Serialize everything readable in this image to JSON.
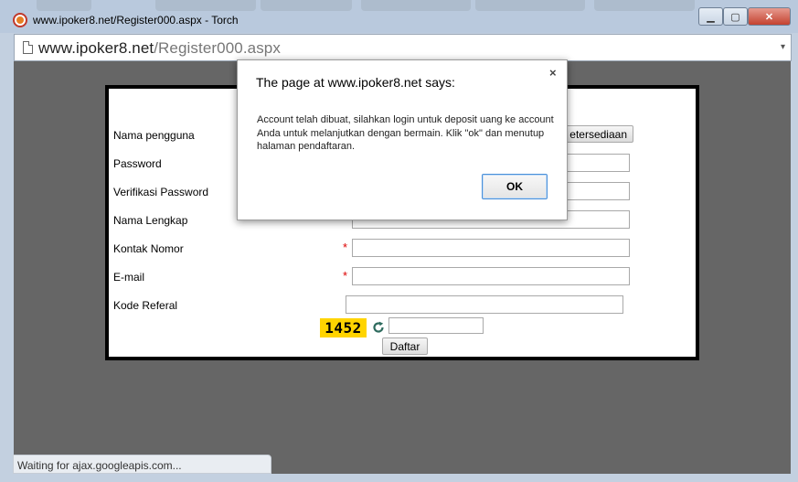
{
  "window": {
    "title": "www.ipoker8.net/Register000.aspx - Torch",
    "controls": {
      "minimize": "▁",
      "maximize": "▢",
      "close": "✕"
    }
  },
  "address_bar": {
    "host": "www.ipoker8.net",
    "path": "/Register000.aspx",
    "dropdown_icon": "▾"
  },
  "form": {
    "fields": [
      {
        "label": "Nama pengguna",
        "required": false,
        "value": ""
      },
      {
        "label": "Password",
        "required": false,
        "value": ""
      },
      {
        "label": "Verifikasi Password",
        "required": false,
        "value": ""
      },
      {
        "label": "Nama Lengkap",
        "required": false,
        "value": ""
      },
      {
        "label": "Kontak Nomor",
        "required": true,
        "value": ""
      },
      {
        "label": "E-mail",
        "required": true,
        "value": ""
      },
      {
        "label": "Kode Referal",
        "required": false,
        "value": ""
      }
    ],
    "required_marker": "*",
    "availability_button": "etersediaan",
    "captcha_code": "1452",
    "captcha_input": "",
    "submit_button": "Daftar"
  },
  "dialog": {
    "title": "The page at www.ipoker8.net says:",
    "message": "Account telah dibuat, silahkan login untuk deposit uang ke account Anda untuk melanjutkan dengan bermain. Klik \"ok\" dan menutup halaman pendaftaran.",
    "ok_button": "OK",
    "close_glyph": "×"
  },
  "status_bar": {
    "text": "Waiting for ajax.googleapis.com..."
  },
  "colors": {
    "viewport_bg": "#666666",
    "captcha_bg": "#ffd400",
    "required": "#dd0000",
    "dialog_ok_border": "#4a90d9"
  }
}
